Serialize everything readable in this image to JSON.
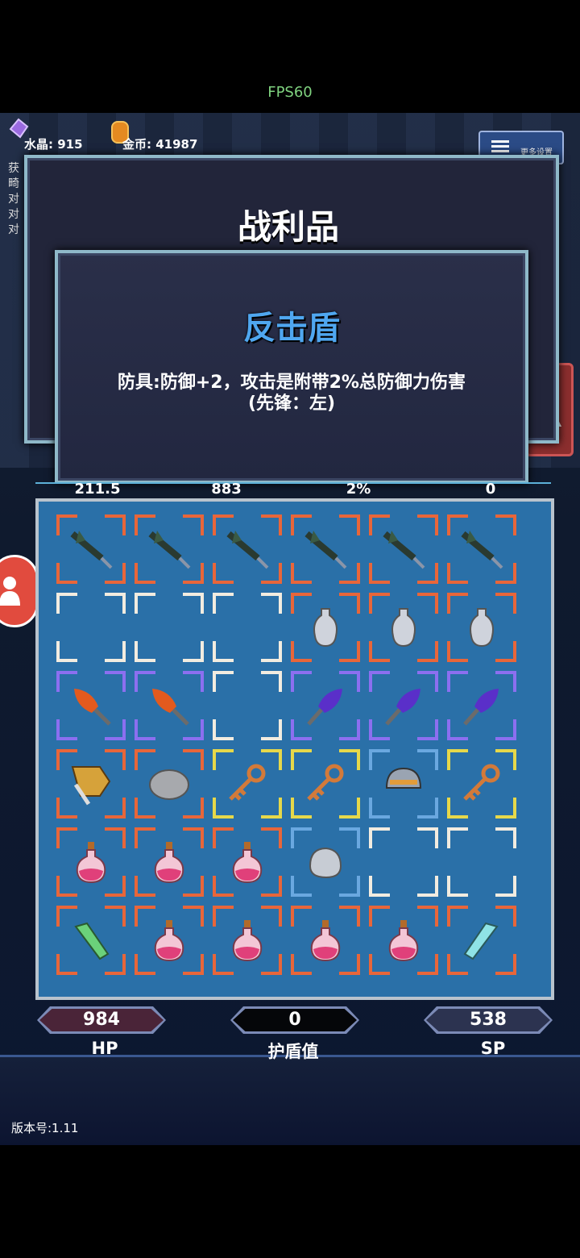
{
  "status": {
    "fps": "FPS60"
  },
  "currency": {
    "crystal_label": "水晶: 915",
    "gold_label": "金币: 41987"
  },
  "more_settings": {
    "label": "更多设置"
  },
  "side_text": [
    "获",
    "畸",
    "对",
    "对",
    "对"
  ],
  "loot": {
    "title": "战利品"
  },
  "item_tooltip": {
    "name": "反击盾",
    "description_line1": "防具:防御+2，攻击是附带2%总防御力伤害",
    "description_line2": "(先锋：左)"
  },
  "stats_row": [
    "211.5",
    "883",
    "2%",
    "0"
  ],
  "inventory": {
    "rows": [
      [
        {
          "item": "dark-sword-icon",
          "rarity": "orange"
        },
        {
          "item": "dark-sword-icon",
          "rarity": "orange"
        },
        {
          "item": "dark-sword-icon",
          "rarity": "orange"
        },
        {
          "item": "dark-sword-icon",
          "rarity": "orange"
        },
        {
          "item": "dark-sword-icon",
          "rarity": "orange"
        },
        {
          "item": "dark-sword-icon",
          "rarity": "orange"
        }
      ],
      [
        {
          "item": "empty",
          "rarity": "white"
        },
        {
          "item": "empty",
          "rarity": "white"
        },
        {
          "item": "empty",
          "rarity": "white"
        },
        {
          "item": "vase-icon",
          "rarity": "orange"
        },
        {
          "item": "vase-icon",
          "rarity": "orange"
        },
        {
          "item": "vase-icon",
          "rarity": "orange"
        }
      ],
      [
        {
          "item": "fire-dagger-icon",
          "rarity": "purple"
        },
        {
          "item": "fire-dagger-icon",
          "rarity": "purple"
        },
        {
          "item": "empty",
          "rarity": "white"
        },
        {
          "item": "purple-dagger-icon",
          "rarity": "purple"
        },
        {
          "item": "purple-dagger-icon",
          "rarity": "purple"
        },
        {
          "item": "purple-dagger-icon",
          "rarity": "purple"
        }
      ],
      [
        {
          "item": "golden-armor-icon",
          "rarity": "orange"
        },
        {
          "item": "stone-icon",
          "rarity": "orange"
        },
        {
          "item": "key-icon",
          "rarity": "yellow"
        },
        {
          "item": "key-icon",
          "rarity": "yellow"
        },
        {
          "item": "helmet-icon",
          "rarity": "blue"
        },
        {
          "item": "key-icon",
          "rarity": "yellow"
        }
      ],
      [
        {
          "item": "pink-potion-icon",
          "rarity": "orange"
        },
        {
          "item": "pink-potion-icon",
          "rarity": "orange"
        },
        {
          "item": "pink-potion-icon",
          "rarity": "orange"
        },
        {
          "item": "gauntlet-icon",
          "rarity": "blue"
        },
        {
          "item": "empty",
          "rarity": "white"
        },
        {
          "item": "empty",
          "rarity": "white"
        }
      ],
      [
        {
          "item": "green-crystal-icon",
          "rarity": "orange"
        },
        {
          "item": "pink-potion-icon",
          "rarity": "orange"
        },
        {
          "item": "pink-potion-icon",
          "rarity": "orange"
        },
        {
          "item": "pink-potion-icon",
          "rarity": "orange"
        },
        {
          "item": "pink-potion-icon",
          "rarity": "orange"
        },
        {
          "item": "cyan-crystal-icon",
          "rarity": "orange"
        }
      ]
    ]
  },
  "player_stats": {
    "hp_value": "984",
    "hp_label": "HP",
    "shield_value": "0",
    "shield_label": "护盾值",
    "sp_value": "538",
    "sp_label": "SP"
  },
  "version": "版本号:1.11",
  "colors": {
    "orange": "#e8663a",
    "white": "#f2ece0",
    "purple": "#8c6ff0",
    "yellow": "#e6d84a",
    "blue": "#6aa8e0",
    "accent": "#4fa7f0"
  }
}
